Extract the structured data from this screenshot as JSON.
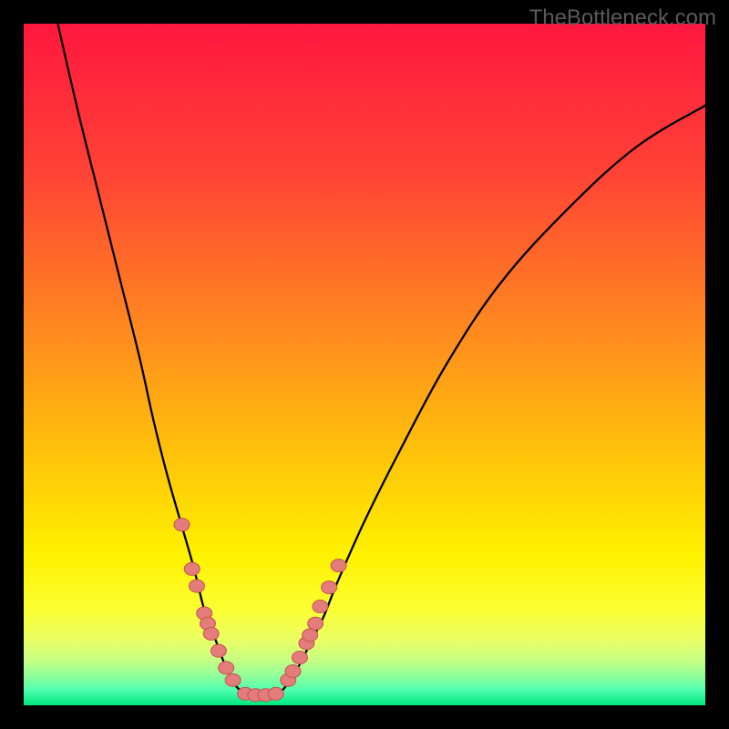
{
  "watermark": "TheBottleneck.com",
  "chart_data": {
    "type": "line",
    "title": "",
    "xlabel": "",
    "ylabel": "",
    "xlim": [
      0,
      100
    ],
    "ylim": [
      0,
      100
    ],
    "grid": false,
    "legend": false,
    "series": [
      {
        "name": "left-arm",
        "x": [
          5,
          8,
          11,
          14,
          17,
          19,
          21,
          23,
          25,
          26.5,
          28,
          29.5,
          31,
          32.5
        ],
        "y": [
          100,
          87,
          75,
          63,
          51,
          42,
          34,
          27,
          20,
          14,
          10,
          6,
          3,
          1.7
        ]
      },
      {
        "name": "right-arm",
        "x": [
          37.5,
          39,
          40.5,
          42,
          44,
          46,
          50,
          55,
          62,
          70,
          80,
          90,
          100
        ],
        "y": [
          1.7,
          3.5,
          6,
          9,
          13,
          18,
          27,
          37,
          50,
          62,
          73,
          82,
          88
        ]
      },
      {
        "name": "valley-floor",
        "x": [
          32.5,
          33.5,
          34.5,
          35.5,
          36.5,
          37.5
        ],
        "y": [
          1.7,
          1.5,
          1.5,
          1.5,
          1.5,
          1.7
        ]
      }
    ],
    "markers": [
      {
        "name": "dots-left",
        "x": [
          23.2,
          24.7,
          25.4,
          26.5,
          27.0,
          27.5,
          28.6,
          29.7,
          30.7
        ],
        "y": [
          26.5,
          20.0,
          17.5,
          13.5,
          12.0,
          10.5,
          8.0,
          5.5,
          3.7
        ]
      },
      {
        "name": "dots-valley",
        "x": [
          32.5,
          34.0,
          35.5,
          37.0
        ],
        "y": [
          1.7,
          1.5,
          1.5,
          1.7
        ]
      },
      {
        "name": "dots-right",
        "x": [
          38.8,
          39.5,
          40.5,
          41.5,
          42.0,
          42.8,
          43.5,
          44.8,
          46.2
        ],
        "y": [
          3.7,
          5.0,
          7.0,
          9.1,
          10.3,
          12.0,
          14.5,
          17.3,
          20.5
        ]
      }
    ],
    "background_gradient": {
      "stops": [
        {
          "offset": 0.0,
          "color": "#ff173f"
        },
        {
          "offset": 0.22,
          "color": "#ff4335"
        },
        {
          "offset": 0.45,
          "color": "#ff8a1f"
        },
        {
          "offset": 0.63,
          "color": "#ffc20a"
        },
        {
          "offset": 0.78,
          "color": "#fff200"
        },
        {
          "offset": 0.86,
          "color": "#fbff33"
        },
        {
          "offset": 0.905,
          "color": "#e9ff66"
        },
        {
          "offset": 0.935,
          "color": "#c4ff84"
        },
        {
          "offset": 0.958,
          "color": "#8dff9c"
        },
        {
          "offset": 0.978,
          "color": "#4fffae"
        },
        {
          "offset": 1.0,
          "color": "#00e77f"
        }
      ]
    },
    "curve_color": "#000000",
    "marker_style": {
      "fill": "#e37c7a",
      "stroke": "#c45452",
      "rx": 8.5,
      "ry": 7
    }
  }
}
